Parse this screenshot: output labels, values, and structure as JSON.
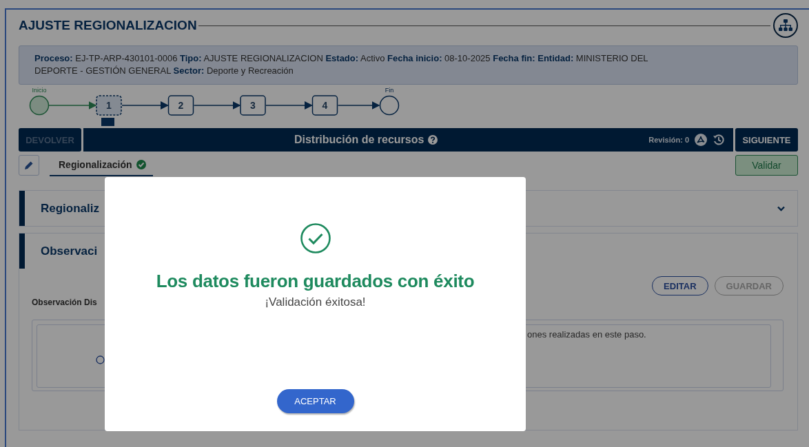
{
  "title": "AJUSTE REGIONALIZACION",
  "info": {
    "text": "**Proceso:** EJ-TP-ARP-430101-0006 **Tipo:** AJUSTE REGIONALIZACION **Estado:** Activo **Fecha inicio:** 08-10-2025 **Fecha fin:** **Entidad:** MINISTERIO DEL DEPORTE - GESTIÓN GENERAL **Sector:** Deporte y Recreación"
  },
  "stepper": {
    "start_label": "Inicio",
    "end_label": "Fin",
    "steps": [
      {
        "label": "1",
        "selected": true
      },
      {
        "label": "2",
        "selected": false
      },
      {
        "label": "3",
        "selected": false
      },
      {
        "label": "4",
        "selected": false
      }
    ]
  },
  "action_bar": {
    "back_button": {
      "label": "DEVOLVER",
      "disabled": true
    },
    "title": "Distribución de recursos",
    "revision": "Revisión: 0",
    "next_button": {
      "label": "SIGUIENTE",
      "disabled": false
    }
  },
  "tabs": [
    {
      "label": "Regionalización",
      "selected": true,
      "validated": true
    }
  ],
  "validate_button": "Validar",
  "panels": [
    {
      "kind": "collapsed",
      "title": "Regionaliz"
    },
    {
      "kind": "observations",
      "title": "Observaci",
      "field_label": "Observación Dis",
      "note": "ones realizadas en este paso.",
      "buttons": [
        {
          "label": "EDITAR",
          "disabled": false
        },
        {
          "label": "GUARDAR",
          "disabled": true
        }
      ]
    }
  ],
  "modal": {
    "title": "Los datos fueron guardados con éxito",
    "message": "¡Validación éxitosa!",
    "button": "ACEPTAR"
  }
}
